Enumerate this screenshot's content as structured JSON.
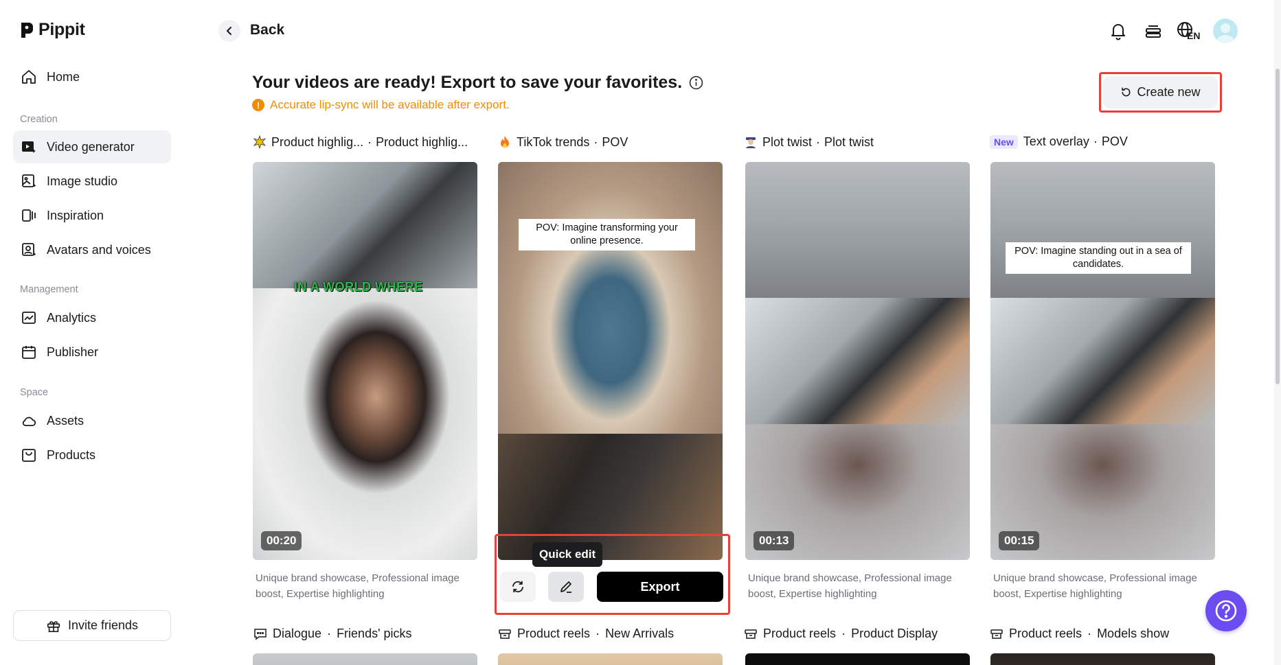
{
  "app": {
    "name": "Pippit"
  },
  "sidebar": {
    "items_top": [
      {
        "label": "Home",
        "icon": "home-icon"
      }
    ],
    "creation": {
      "label": "Creation",
      "items": [
        {
          "label": "Video generator",
          "icon": "video-generator-icon",
          "active": true
        },
        {
          "label": "Image studio",
          "icon": "image-studio-icon"
        },
        {
          "label": "Inspiration",
          "icon": "inspiration-icon"
        },
        {
          "label": "Avatars and voices",
          "icon": "avatar-voice-icon"
        }
      ]
    },
    "management": {
      "label": "Management",
      "items": [
        {
          "label": "Analytics",
          "icon": "analytics-icon"
        },
        {
          "label": "Publisher",
          "icon": "calendar-icon"
        }
      ]
    },
    "space": {
      "label": "Space",
      "items": [
        {
          "label": "Assets",
          "icon": "cloud-icon"
        },
        {
          "label": "Products",
          "icon": "products-icon"
        }
      ]
    },
    "invite_label": "Invite friends"
  },
  "header": {
    "back_label": "Back",
    "lang_code": "EN"
  },
  "main": {
    "title": "Your videos are ready! Export to save your favorites.",
    "notice": "Accurate lip-sync will be available after export.",
    "create_new_label": "Create new",
    "cards": [
      {
        "category": "Product highlig...",
        "style": "Product highlig...",
        "duration": "00:20",
        "overlay_text": "IN A WORLD WHERE",
        "description": "Unique brand showcase, Professional image boost, Expertise highlighting"
      },
      {
        "category": "TikTok trends",
        "style": "POV",
        "caption": "POV: Imagine transforming your online presence.",
        "tooltip": "Quick edit",
        "export_label": "Export"
      },
      {
        "category": "Plot twist",
        "style": "Plot twist",
        "duration": "00:13",
        "description": "Unique brand showcase, Professional image boost, Expertise highlighting"
      },
      {
        "badge": "New",
        "category": "Text overlay",
        "style": "POV",
        "duration": "00:15",
        "caption": "POV: Imagine standing out in a sea of candidates.",
        "description": "Unique brand showcase, Professional image boost, Expertise highlighting"
      }
    ],
    "row2": [
      {
        "category": "Dialogue",
        "style": "Friends' picks"
      },
      {
        "category": "Product reels",
        "style": "New Arrivals"
      },
      {
        "category": "Product reels",
        "style": "Product Display"
      },
      {
        "category": "Product reels",
        "style": "Models show"
      }
    ],
    "separator": "·"
  },
  "colors": {
    "accent": "#6a4cf0",
    "warning": "#f08c00",
    "highlight_outline": "#e5403a"
  }
}
